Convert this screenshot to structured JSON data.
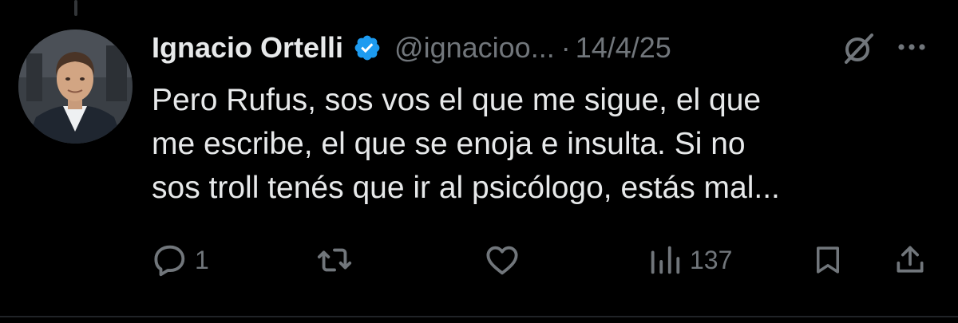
{
  "tweet": {
    "author_name": "Ignacio Ortelli",
    "handle": "@ignacioo...",
    "separator": "·",
    "date": "14/4/25",
    "verified": true,
    "text_lines": [
      "Pero Rufus, sos vos el que me sigue, el que",
      "me escribe, el que se enoja e insulta. Si no",
      "sos troll tenés que ir al psicólogo, estás mal..."
    ]
  },
  "actions": {
    "replies": "1",
    "reposts": "",
    "likes": "",
    "views": "137"
  },
  "icons": {
    "avatar": "profile-photo",
    "verified": "verified-badge-icon",
    "grok": "grok-icon",
    "more": "more-options-icon",
    "reply": "reply-icon",
    "repost": "repost-icon",
    "like": "heart-icon",
    "views": "views-chart-icon",
    "bookmark": "bookmark-icon",
    "share": "share-icon"
  },
  "colors": {
    "background": "#000000",
    "primary_text": "#e7e9ea",
    "secondary_text": "#71767b",
    "verified_blue": "#1d9bf0"
  }
}
